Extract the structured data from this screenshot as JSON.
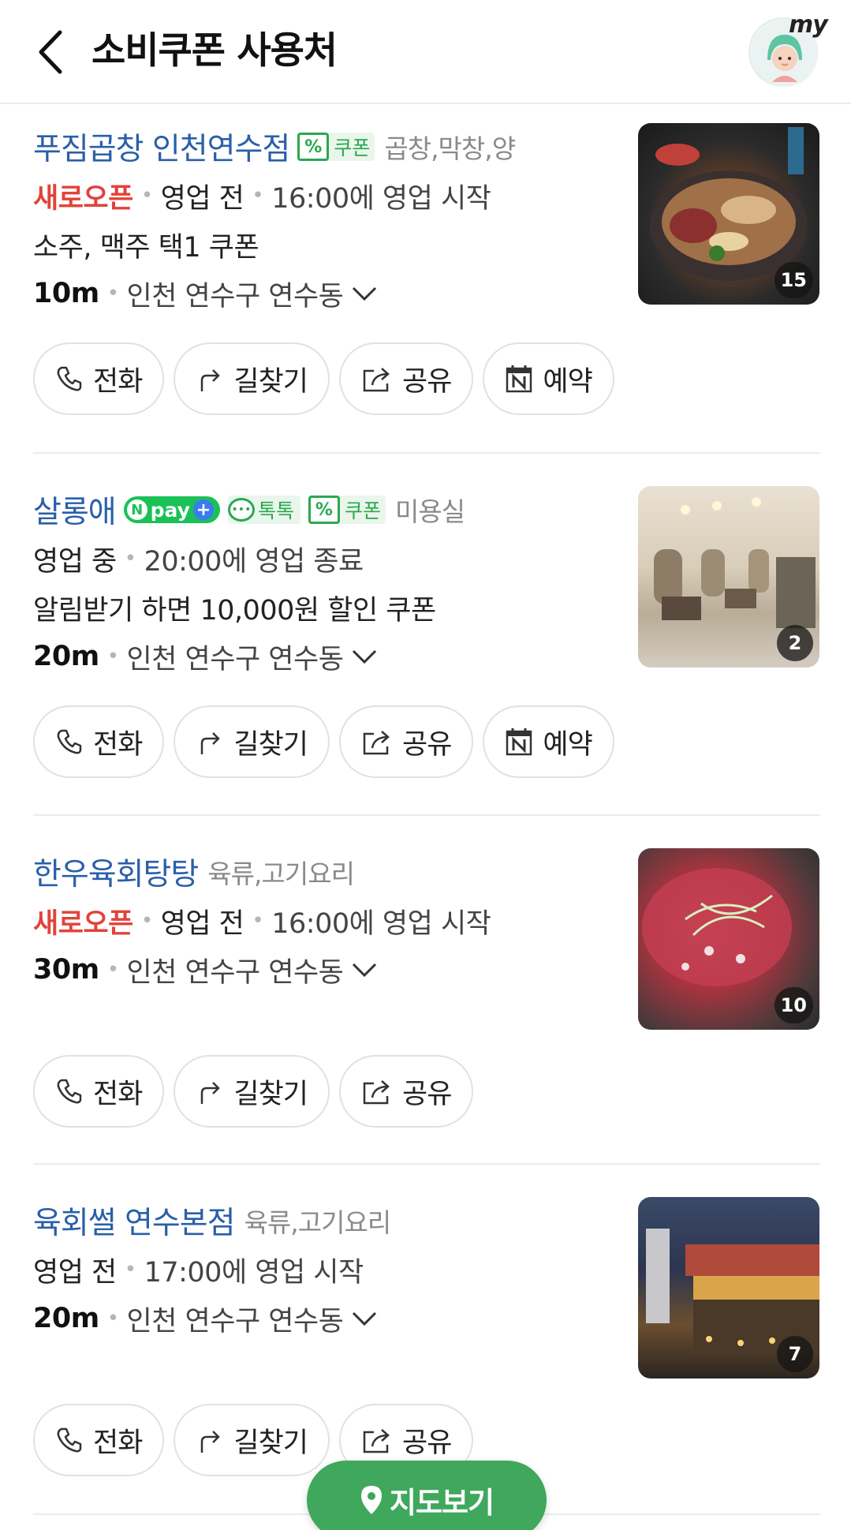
{
  "header": {
    "title": "소비쿠폰 사용처",
    "avatar_label": "my"
  },
  "places": [
    {
      "name": "푸짐곱창 인천연수점",
      "badges": [
        "coupon"
      ],
      "coupon_label": "쿠폰",
      "category": "곱창,막창,양",
      "new_open": "새로오픈",
      "status": "영업 전",
      "time": "16:00에 영업 시작",
      "promo": "소주, 맥주 택1 쿠폰",
      "distance": "10m",
      "address": "인천 연수구 연수동",
      "photo_count": "15",
      "actions": [
        "전화",
        "길찾기",
        "공유",
        "예약"
      ]
    },
    {
      "name": "살롱애",
      "badges": [
        "npay",
        "talk",
        "coupon"
      ],
      "npay_label": "pay",
      "talk_label": "톡톡",
      "coupon_label": "쿠폰",
      "category": "미용실",
      "status": "영업 중",
      "time": "20:00에 영업 종료",
      "promo": "알림받기 하면 10,000원 할인 쿠폰",
      "distance": "20m",
      "address": "인천 연수구 연수동",
      "photo_count": "2",
      "actions": [
        "전화",
        "길찾기",
        "공유",
        "예약"
      ]
    },
    {
      "name": "한우육회탕탕",
      "category": "육류,고기요리",
      "new_open": "새로오픈",
      "status": "영업 전",
      "time": "16:00에 영업 시작",
      "distance": "30m",
      "address": "인천 연수구 연수동",
      "photo_count": "10",
      "actions": [
        "전화",
        "길찾기",
        "공유"
      ]
    },
    {
      "name": "육회썰 연수본점",
      "category": "육류,고기요리",
      "status": "영업 전",
      "time": "17:00에 영업 시작",
      "distance": "20m",
      "address": "인천 연수구 연수동",
      "photo_count": "7",
      "actions": [
        "전화",
        "길찾기",
        "공유"
      ]
    }
  ],
  "map_button": "지도보기",
  "icons": {
    "back": "chevron-left-icon",
    "phone": "phone-icon",
    "directions": "turn-arrow-icon",
    "share": "share-icon",
    "booking": "naver-booking-icon",
    "chevron": "chevron-down-icon",
    "pin": "map-pin-icon"
  },
  "colors": {
    "place_name": "#2a5fa8",
    "new_open": "#e0433a",
    "map_button": "#3fa85c",
    "badge_green": "#2aa84f"
  }
}
